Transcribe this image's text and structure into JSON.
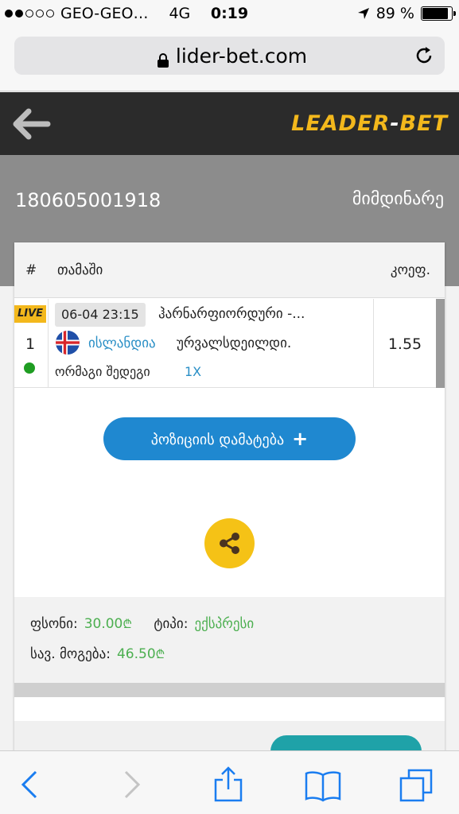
{
  "status_bar": {
    "carrier": "GEO-GEO…",
    "network": "4G",
    "time": "0:19",
    "battery": "89 %",
    "battery_level": 0.89,
    "signal_bars_filled": 2,
    "signal_bars_total": 5
  },
  "browser": {
    "url": "lider-bet.com"
  },
  "header": {
    "logo_main": "LEADER",
    "logo_dash": "-",
    "logo_end": "BET",
    "brand_color": "#f3b81c"
  },
  "ticket": {
    "id": "180605001918",
    "status": "მიმდინარე"
  },
  "table": {
    "col_num": "#",
    "col_game": "თამაში",
    "col_coef": "კოეფ.",
    "rows": [
      {
        "live_label": "LIVE",
        "number": "1",
        "datetime": "06-04 23:15",
        "event": "ჰარნარფიორდური -...",
        "team": "ისლანდია",
        "team_rest": "ურვალსდეილდი.",
        "market": "ორმაგი შედეგი",
        "pick": "1X",
        "coef": "1.55",
        "flag": "iceland-flag",
        "status_color": "#1f9d22"
      }
    ]
  },
  "actions": {
    "add_position": "პოზიციის დამატება",
    "add_icon": "+",
    "share_icon": "share-icon"
  },
  "summary": {
    "stake_label": "ფსონი:",
    "stake_value": "30.00",
    "currency": "₾",
    "type_label": "ტიპი:",
    "type_value": "ექსპრესი",
    "payout_label": "სავ. მოგება:",
    "payout_value": "46.50"
  },
  "colors": {
    "accent_blue": "#1f88d0",
    "link_blue": "#2a8fc6",
    "money_green": "#4caf50",
    "share_yellow": "#f5c216"
  }
}
